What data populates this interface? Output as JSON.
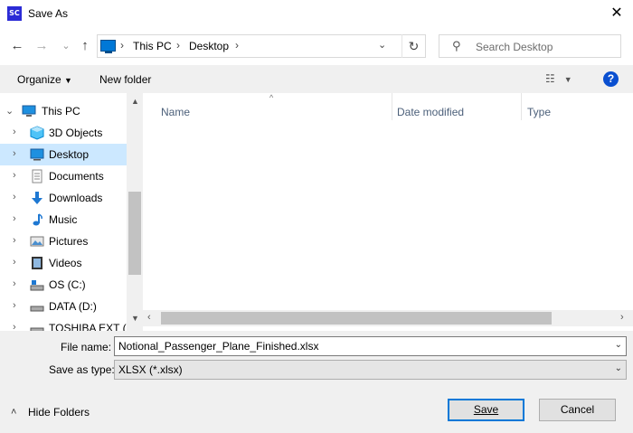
{
  "window": {
    "title": "Save As",
    "app_icon_text": "SC",
    "close_glyph": "✕"
  },
  "nav": {
    "back_glyph": "←",
    "forward_glyph": "→",
    "recent_glyph": "⌄",
    "up_glyph": "↑",
    "breadcrumb": [
      "This PC",
      "Desktop"
    ],
    "refresh_glyph": "↻",
    "search_placeholder": "Search Desktop"
  },
  "toolbar": {
    "organize_label": "Organize",
    "new_folder_label": "New folder",
    "help_label": "?"
  },
  "tree": [
    {
      "label": "This PC",
      "icon": "computer-icon",
      "level": 0,
      "expanded": true
    },
    {
      "label": "3D Objects",
      "icon": "3d-objects-icon",
      "level": 1
    },
    {
      "label": "Desktop",
      "icon": "desktop-icon",
      "level": 1,
      "selected": true
    },
    {
      "label": "Documents",
      "icon": "documents-icon",
      "level": 1
    },
    {
      "label": "Downloads",
      "icon": "downloads-icon",
      "level": 1
    },
    {
      "label": "Music",
      "icon": "music-icon",
      "level": 1
    },
    {
      "label": "Pictures",
      "icon": "pictures-icon",
      "level": 1
    },
    {
      "label": "Videos",
      "icon": "videos-icon",
      "level": 1
    },
    {
      "label": "OS (C:)",
      "icon": "drive-icon",
      "level": 1
    },
    {
      "label": "DATA (D:)",
      "icon": "drive-icon",
      "level": 1
    },
    {
      "label": "TOSHIBA EXT (E:)",
      "icon": "drive-icon",
      "level": 1
    }
  ],
  "columns": {
    "name": "Name",
    "date_modified": "Date modified",
    "type": "Type"
  },
  "form": {
    "file_name_label": "File name:",
    "file_name_value": "Notional_Passenger_Plane_Finished.xlsx",
    "save_type_label": "Save as type:",
    "save_type_value": "XLSX (*.xlsx)"
  },
  "buttons": {
    "hide_folders": "Hide Folders",
    "save": "Save",
    "cancel": "Cancel"
  },
  "colors": {
    "accent": "#0078d7",
    "selected_bg": "#cce8ff",
    "panel_bg": "#f0f0f0"
  }
}
